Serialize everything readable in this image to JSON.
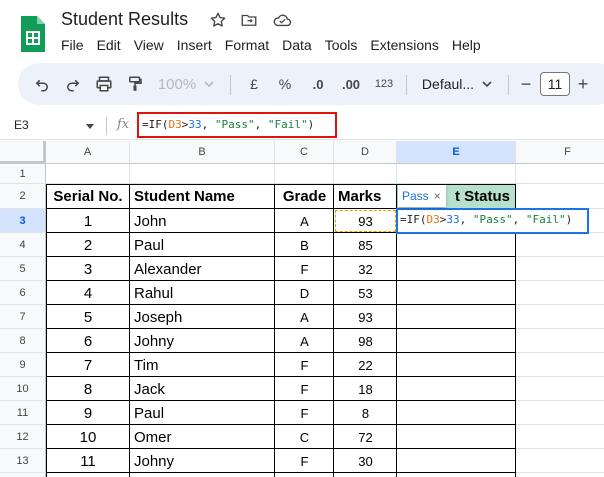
{
  "document": {
    "title": "Student Results"
  },
  "menu": [
    "File",
    "Edit",
    "View",
    "Insert",
    "Format",
    "Data",
    "Tools",
    "Extensions",
    "Help"
  ],
  "toolbar": {
    "zoom": "100%",
    "currency": "£",
    "percent": "%",
    "decrease_decimal": ".0",
    "increase_decimal": ".00",
    "number_format": "123",
    "font": "Defaul...",
    "font_size": "11"
  },
  "formula_bar": {
    "name_box": "E3",
    "fx": "fx",
    "formula": {
      "p1": "=IF(",
      "ref": "D3",
      "p2": ">",
      "num": "33",
      "p3": ", ",
      "s1": "\"Pass\"",
      "p4": ", ",
      "s2": "\"Fail\"",
      "p5": ")"
    }
  },
  "grid": {
    "columns": [
      "A",
      "B",
      "C",
      "D",
      "E",
      "F"
    ],
    "rows": [
      "1",
      "2",
      "3",
      "4",
      "5",
      "6",
      "7",
      "8",
      "9",
      "10",
      "11",
      "12",
      "13",
      "14"
    ],
    "headers": [
      "Serial No.",
      "Student Name",
      "Grade",
      "Marks",
      "t Status"
    ],
    "data": [
      [
        "1",
        "John",
        "A",
        "93"
      ],
      [
        "2",
        "Paul",
        "B",
        "85"
      ],
      [
        "3",
        "Alexander",
        "F",
        "32"
      ],
      [
        "4",
        "Rahul",
        "D",
        "53"
      ],
      [
        "5",
        "Joseph",
        "A",
        "93"
      ],
      [
        "6",
        "Johny",
        "A",
        "98"
      ],
      [
        "7",
        "Tim",
        "F",
        "22"
      ],
      [
        "8",
        "Jack",
        "F",
        "18"
      ],
      [
        "9",
        "Paul",
        "F",
        "8"
      ],
      [
        "10",
        "Omer",
        "C",
        "72"
      ],
      [
        "11",
        "Johny",
        "F",
        "30"
      ]
    ],
    "tooltip": {
      "text": "Pass",
      "close": "×"
    }
  },
  "colors": {
    "accent": "#1a73e8",
    "formula_highlight_border": "#e0120b",
    "status_header_bg": "#b7e1cd",
    "reference_dash": "#f29900"
  }
}
